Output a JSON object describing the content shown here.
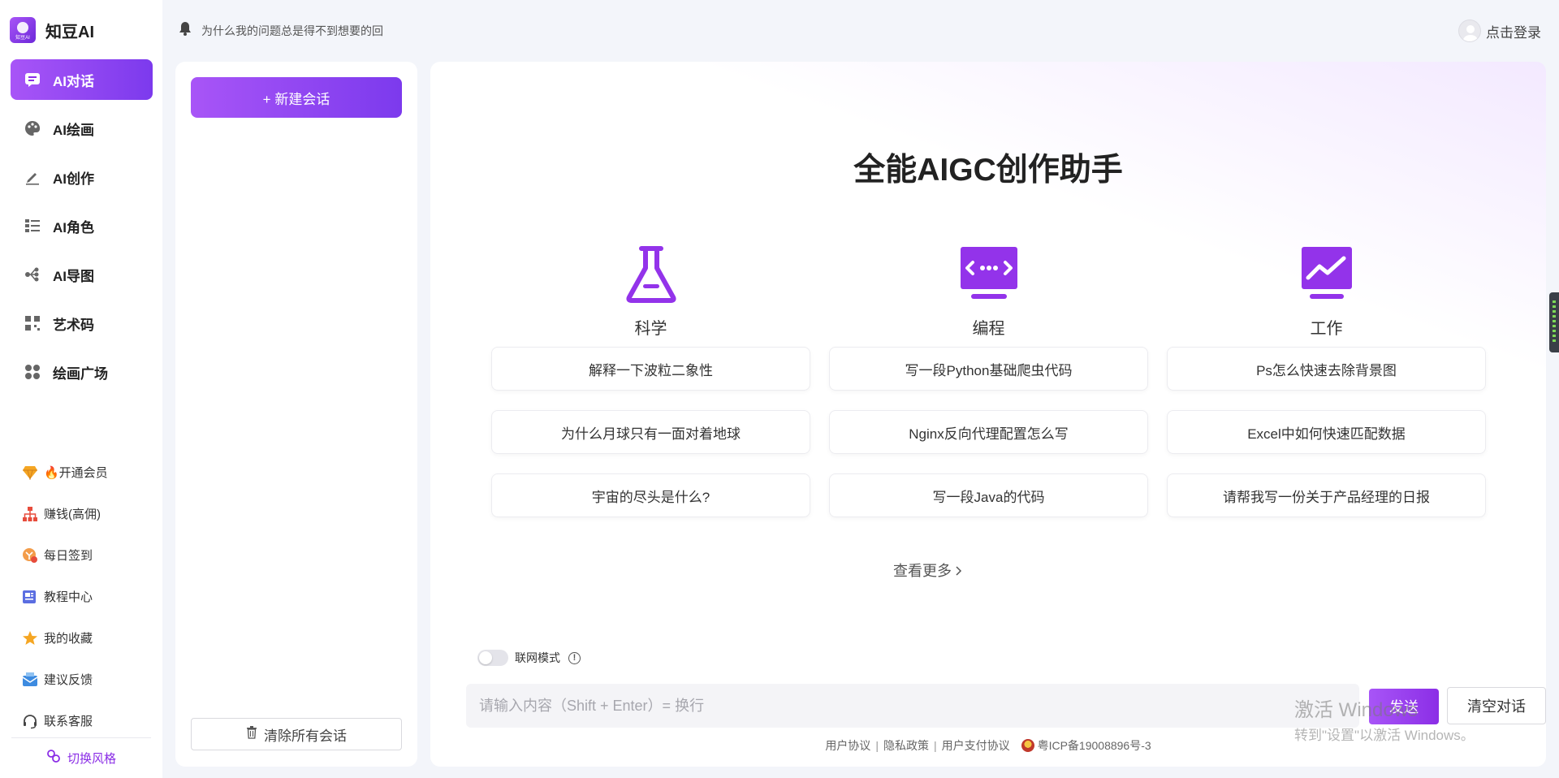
{
  "brand": {
    "name": "知豆AI",
    "logo_caption": "知豆AI"
  },
  "sidebar": {
    "items": [
      {
        "label": "AI对话",
        "icon": "chat-icon",
        "active": true
      },
      {
        "label": "AI绘画",
        "icon": "palette-icon",
        "active": false
      },
      {
        "label": "AI创作",
        "icon": "pen-icon",
        "active": false
      },
      {
        "label": "AI角色",
        "icon": "list-icon",
        "active": false
      },
      {
        "label": "AI导图",
        "icon": "mindmap-icon",
        "active": false
      },
      {
        "label": "艺术码",
        "icon": "qrcode-icon",
        "active": false
      },
      {
        "label": "绘画广场",
        "icon": "grid-icon",
        "active": false
      }
    ],
    "secondary": [
      {
        "label": "🔥开通会员",
        "icon": "diamond-icon"
      },
      {
        "label": "赚钱(高佣)",
        "icon": "org-chart-icon"
      },
      {
        "label": "每日签到",
        "icon": "checkin-icon"
      },
      {
        "label": "教程中心",
        "icon": "document-icon"
      },
      {
        "label": "我的收藏",
        "icon": "star-icon"
      },
      {
        "label": "建议反馈",
        "icon": "mail-icon"
      },
      {
        "label": "联系客服",
        "icon": "headset-icon"
      }
    ],
    "theme_switch": "切换风格"
  },
  "header": {
    "notice": "为什么我的问题总是得不到想要的回",
    "login": "点击登录"
  },
  "history": {
    "new_chat": "+ 新建会话",
    "clear_all": "清除所有会话"
  },
  "main": {
    "title": "全能AIGC创作助手",
    "columns": [
      {
        "label": "科学",
        "icon": "flask-icon",
        "prompts": [
          "解释一下波粒二象性",
          "为什么月球只有一面对着地球",
          "宇宙的尽头是什么?"
        ]
      },
      {
        "label": "编程",
        "icon": "code-icon",
        "prompts": [
          "写一段Python基础爬虫代码",
          "Nginx反向代理配置怎么写",
          "写一段Java的代码"
        ]
      },
      {
        "label": "工作",
        "icon": "chart-icon",
        "prompts": [
          "Ps怎么快速去除背景图",
          "Excel中如何快速匹配数据",
          "请帮我写一份关于产品经理的日报"
        ]
      }
    ],
    "see_more": "查看更多",
    "net_mode": "联网模式",
    "net_mode_on": false,
    "input_placeholder": "请输入内容（Shift + Enter）= 换行",
    "input_value": "",
    "send": "发送",
    "clear_chat": "清空对话"
  },
  "footer": {
    "links": [
      "用户协议",
      "隐私政策",
      "用户支付协议"
    ],
    "icp": "粤ICP备19008896号-3"
  },
  "watermark": {
    "line1": "激活 Windows",
    "line2": "转到\"设置\"以激活 Windows。"
  },
  "colors": {
    "accent": "#8b2ee6",
    "accent_gradient_start": "#a855f7",
    "accent_gradient_end": "#7c3aed",
    "background": "#f3f5fa"
  }
}
